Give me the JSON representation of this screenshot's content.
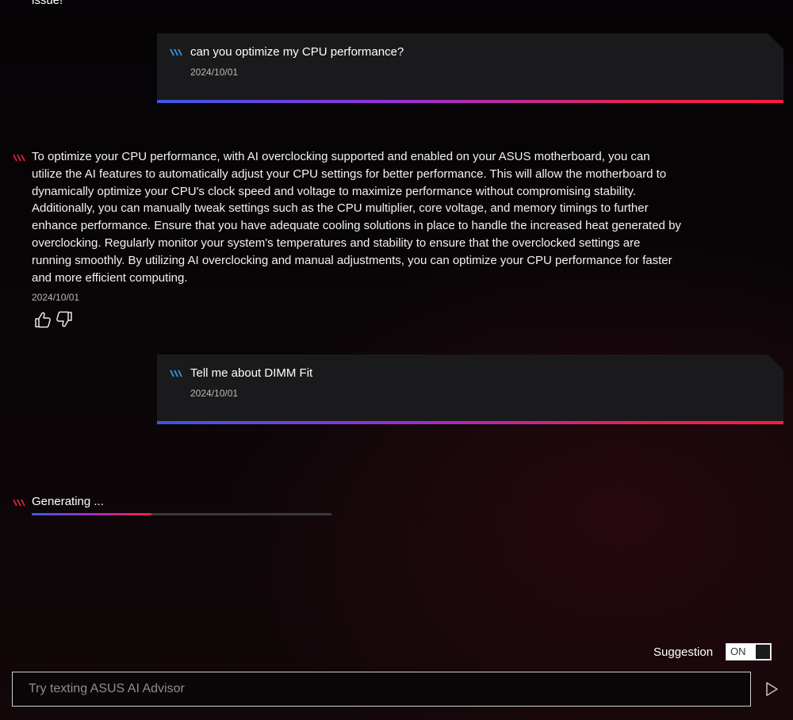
{
  "previous_message": {
    "trailing_text": "issue!"
  },
  "messages": [
    {
      "role": "user",
      "text": "can you optimize my CPU performance?",
      "date": "2024/10/01"
    },
    {
      "role": "assistant",
      "text": "To optimize your CPU performance, with AI overclocking supported and enabled on your ASUS motherboard, you can utilize the AI features to automatically adjust your CPU settings for better performance. This will allow the motherboard to dynamically optimize your CPU's clock speed and voltage to maximize performance without compromising stability. Additionally, you can manually tweak settings such as the CPU multiplier, core voltage, and memory timings to further enhance performance. Ensure that you have adequate cooling solutions in place to handle the increased heat generated by overclocking. Regularly monitor your system's temperatures and stability to ensure that the overclocked settings are running smoothly. By utilizing AI overclocking and manual adjustments, you can optimize your CPU performance for faster and more efficient computing.",
      "date": "2024/10/01"
    },
    {
      "role": "user",
      "text": "Tell me about DIMM Fit",
      "date": "2024/10/01"
    }
  ],
  "feedback": {
    "like_icon": "thumbs-up-icon",
    "dislike_icon": "thumbs-down-icon"
  },
  "generating": {
    "label": "Generating ...",
    "progress": 0.4
  },
  "suggestion": {
    "label": "Suggestion",
    "state": "ON"
  },
  "input": {
    "placeholder": "Try texting ASUS AI Advisor",
    "value": ""
  },
  "send": {
    "icon": "send-icon"
  },
  "colors": {
    "user_stripes": "#2a9fe8",
    "assistant_stripes": "#e0203a",
    "gradient_start": "#3b57e8",
    "gradient_end": "#ff1a40"
  }
}
